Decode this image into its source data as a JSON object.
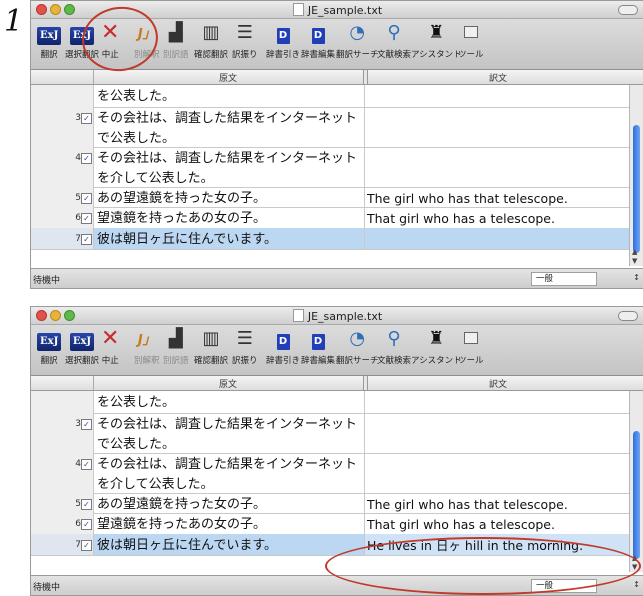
{
  "step_number": "1",
  "colors": {
    "annotation": "#c0392b",
    "selection": "#bcd7f2",
    "accent": "#2846a8"
  },
  "window": {
    "title": "JE_sample.txt"
  },
  "toolbar": {
    "items": [
      {
        "label": "翻訳",
        "icon": "ExJ-translate-icon",
        "glyph": "ExJ"
      },
      {
        "label": "選択翻訳",
        "icon": "ExJ-selection-icon",
        "glyph": "ExJ"
      },
      {
        "label": "中止",
        "icon": "stop-x-icon",
        "glyph": "✕"
      },
      {
        "label": "別解釈",
        "icon": "alt-interpretation-icon",
        "glyph": "J」"
      },
      {
        "label": "別訳語",
        "icon": "alt-word-icon",
        "glyph": "▟"
      },
      {
        "label": "確認翻訳",
        "icon": "confirm-translation-icon",
        "glyph": "▥"
      },
      {
        "label": "訳振り",
        "icon": "assign-translation-icon",
        "glyph": "☰"
      },
      {
        "label": "辞書引き",
        "icon": "dictionary-lookup-icon",
        "glyph": "D"
      },
      {
        "label": "辞書編集",
        "icon": "dictionary-edit-icon",
        "glyph": "D"
      },
      {
        "label": "翻訳サーチ",
        "icon": "translation-search-icon",
        "glyph": "◔"
      },
      {
        "label": "文献検索",
        "icon": "document-search-icon",
        "glyph": "⚲"
      },
      {
        "label": "アシスタント",
        "icon": "assistant-icon",
        "glyph": "♜"
      },
      {
        "label": "ツール",
        "icon": "tools-icon",
        "glyph": ""
      }
    ]
  },
  "columns": {
    "source": "原文",
    "target": "訳文"
  },
  "rows_before": [
    {
      "num": "",
      "checked": false,
      "source": "を公表した。",
      "target": ""
    },
    {
      "num": "3",
      "checked": true,
      "source": "その会社は、調査した結果をインターネットで公表した。",
      "target": ""
    },
    {
      "num": "4",
      "checked": true,
      "source": "その会社は、調査した結果をインターネットを介して公表した。",
      "target": ""
    },
    {
      "num": "5",
      "checked": true,
      "source": "あの望遠鏡を持った女の子。",
      "target": "The girl who has that telescope."
    },
    {
      "num": "6",
      "checked": true,
      "source": "望遠鏡を持ったあの女の子。",
      "target": "That girl who has a telescope."
    },
    {
      "num": "7",
      "checked": true,
      "source": "彼は朝日ヶ丘に住んでいます。",
      "target": ""
    }
  ],
  "rows_after": [
    {
      "num": "",
      "checked": false,
      "source": "を公表した。",
      "target": ""
    },
    {
      "num": "3",
      "checked": true,
      "source": "その会社は、調査した結果をインターネットで公表した。",
      "target": ""
    },
    {
      "num": "4",
      "checked": true,
      "source": "その会社は、調査した結果をインターネットを介して公表した。",
      "target": ""
    },
    {
      "num": "5",
      "checked": true,
      "source": "あの望遠鏡を持った女の子。",
      "target": "The girl who has that telescope."
    },
    {
      "num": "6",
      "checked": true,
      "source": "望遠鏡を持ったあの女の子。",
      "target": "That girl who has a telescope."
    },
    {
      "num": "7",
      "checked": true,
      "source": "彼は朝日ヶ丘に住んでいます。",
      "target": "He lives in 日ヶ hill in the morning."
    }
  ],
  "status": {
    "text": "待機中",
    "select_value": "一般"
  }
}
